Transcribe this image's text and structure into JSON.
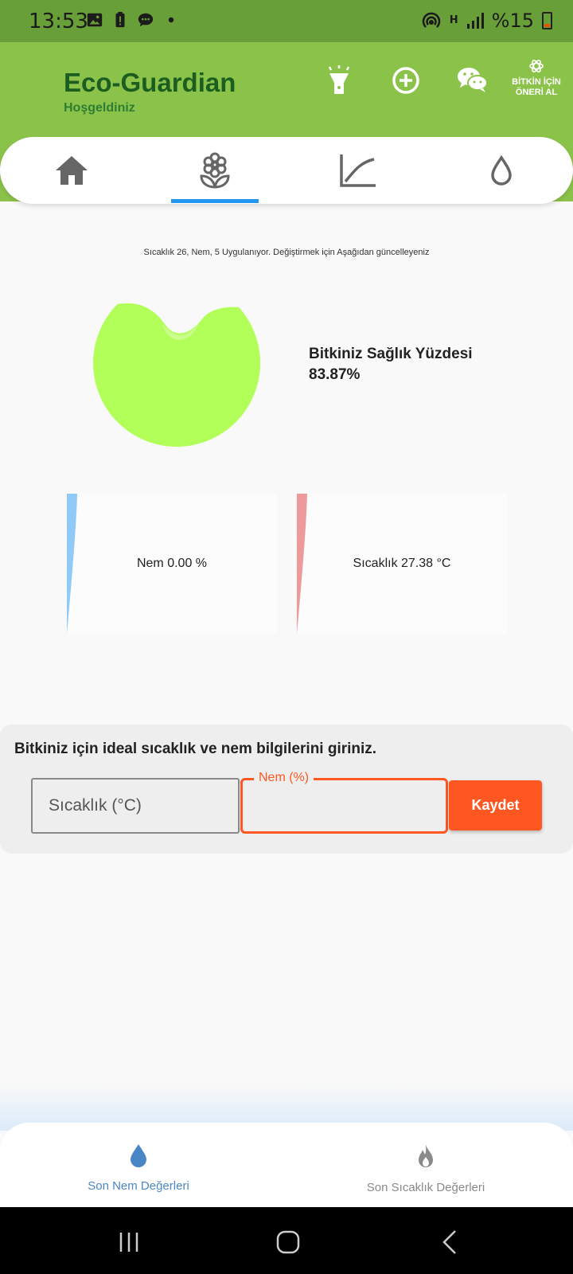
{
  "status_bar": {
    "time": "13:53",
    "network_type": "H",
    "battery": "%15"
  },
  "header": {
    "title": "Eco-Guardian",
    "subtitle": "Hoşgeldiniz",
    "suggest_label": "BİTKİN İÇİN ÖNERİ AL",
    "icons": [
      "flashlight-icon",
      "add-circle-icon",
      "wechat-icon",
      "openai-icon"
    ]
  },
  "tabs": [
    {
      "icon": "home-icon",
      "selected": false
    },
    {
      "icon": "flower-icon",
      "selected": true
    },
    {
      "icon": "chart-icon",
      "selected": false
    },
    {
      "icon": "water-drop-icon",
      "selected": false
    }
  ],
  "main": {
    "info_text": "Sıcaklık 26, Nem, 5 Uygulanıyor. Değiştirmek için Aşağıdan güncelleyeniz",
    "health_title": "Bitkiniz Sağlık Yüzdesi",
    "health_value": "83.87%",
    "health_fraction": 0.8387,
    "humidity_card": "Nem 0.00 %",
    "temperature_card": "Sıcaklık 27.38 °C"
  },
  "form": {
    "heading": "Bitkiniz için ideal sıcaklık ve nem bilgilerini giriniz.",
    "temp_placeholder": "Sıcaklık (°C)",
    "temp_value": "",
    "humidity_label": "Nem (%)",
    "humidity_value": "",
    "save_label": "Kaydet"
  },
  "bottom_nav": {
    "items": [
      {
        "label": "Son Nem Değerleri",
        "icon": "water-drop-icon",
        "active": true
      },
      {
        "label": "Son Sıcaklık Değerleri",
        "icon": "fire-icon",
        "active": false
      }
    ]
  },
  "colors": {
    "header_bg": "#8bc34a",
    "status_bg": "#689f38",
    "title_green": "#1b5e20",
    "accent_orange": "#ff5722",
    "tab_indicator": "#2196f3",
    "health_fill": "#b2ff59",
    "humidity_edge": "#90caf9",
    "temperature_edge": "#ef9a9a",
    "nav_active": "#4a86c5",
    "nav_inactive": "#8a8a8a"
  }
}
